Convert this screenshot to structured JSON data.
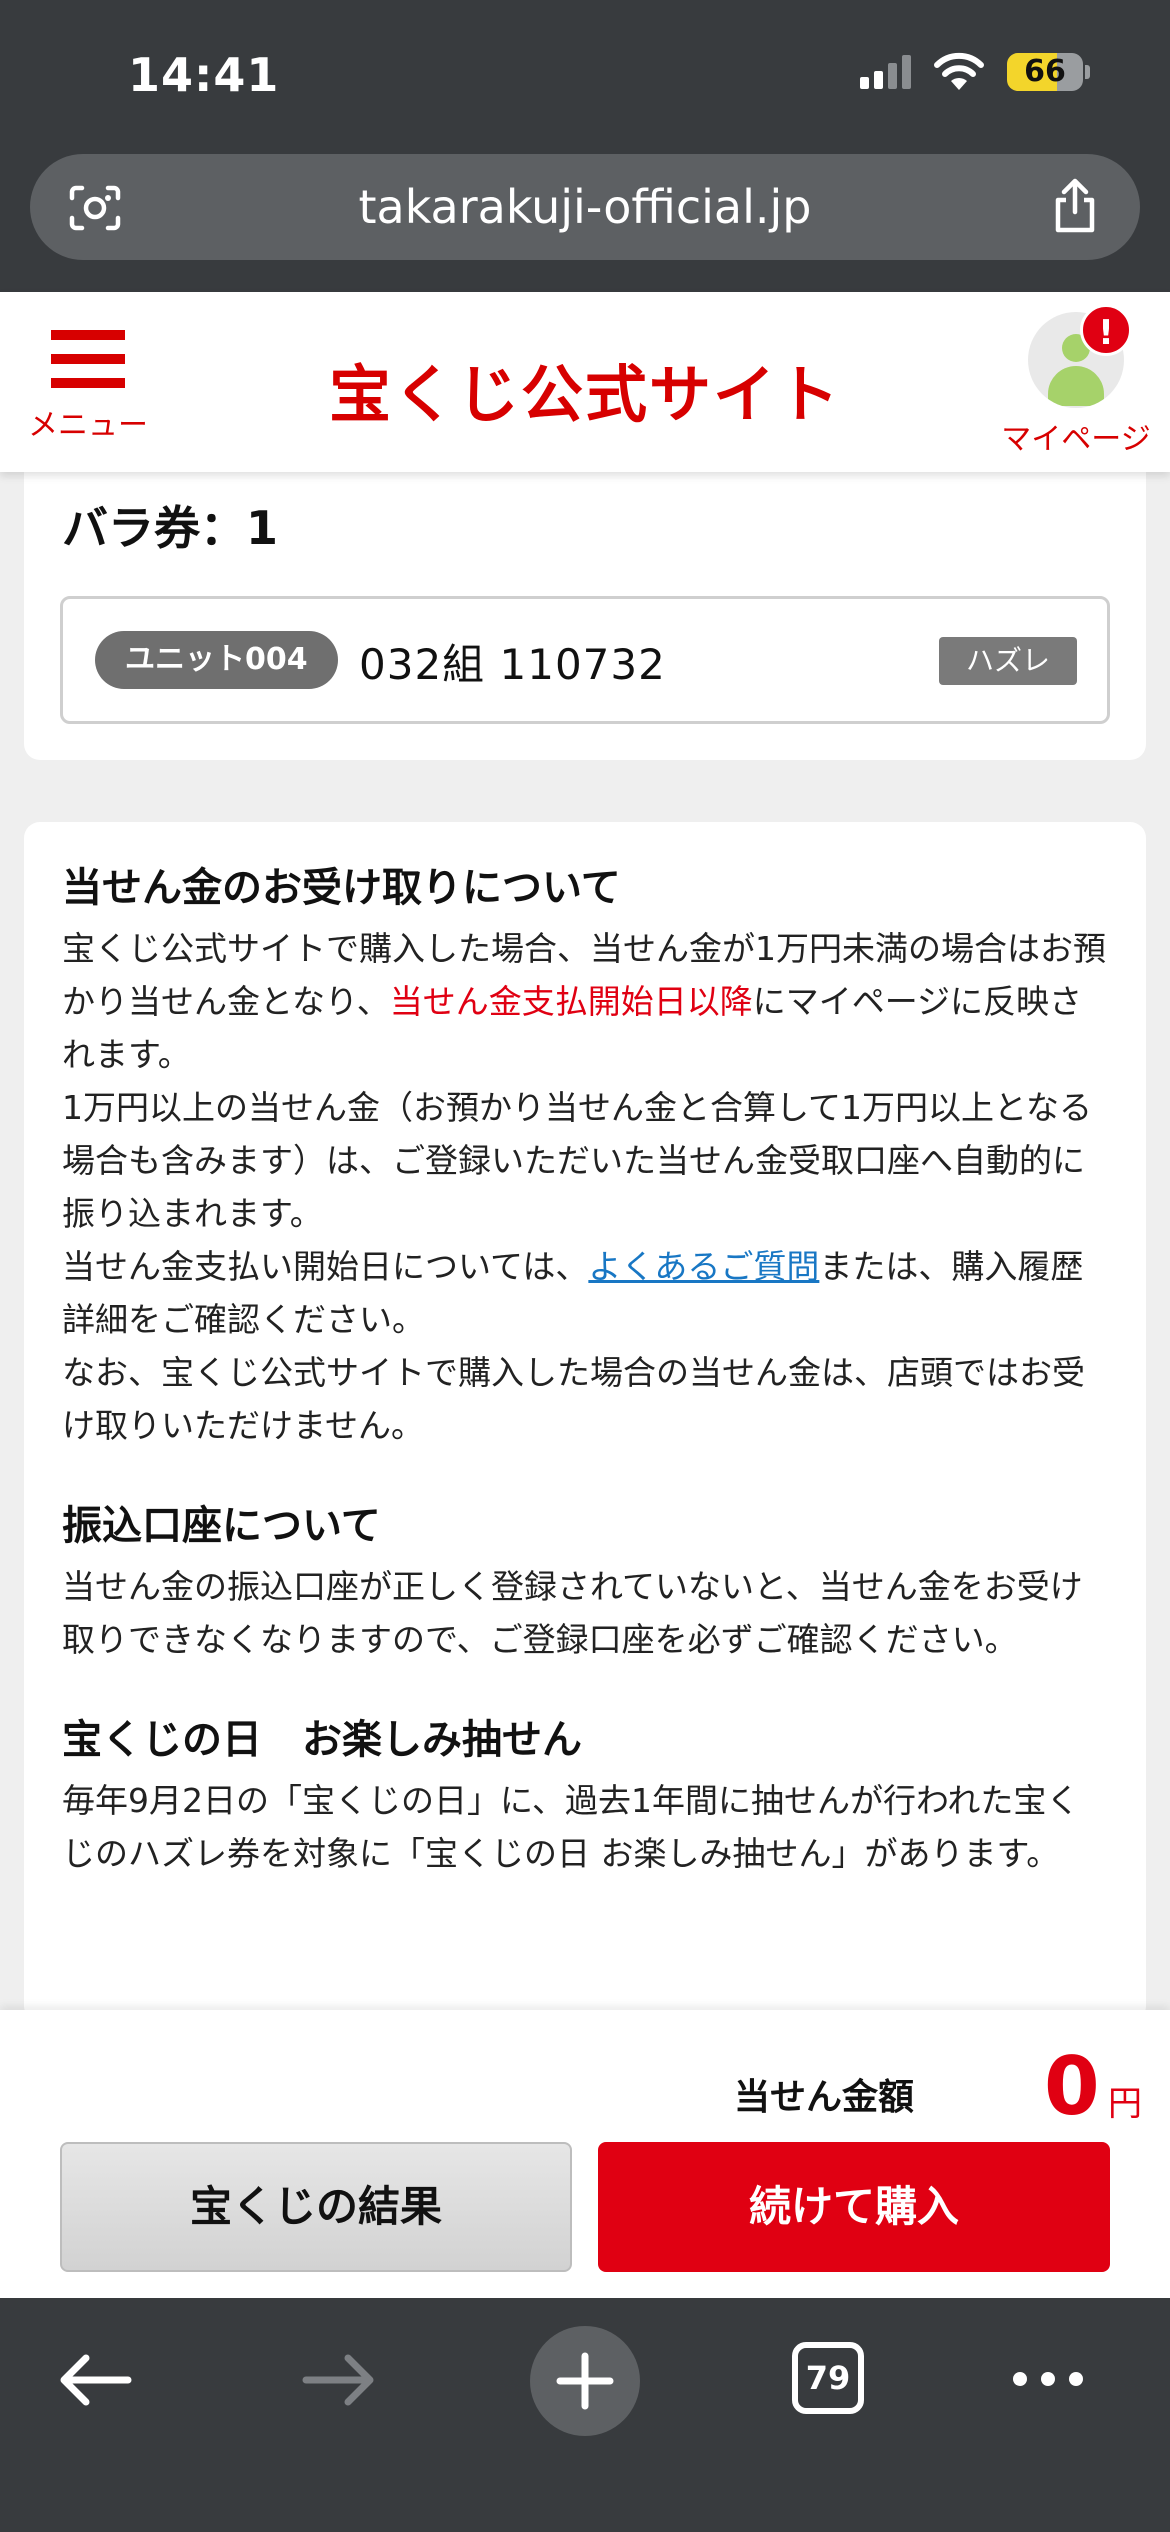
{
  "status_bar": {
    "time": "14:41",
    "battery": "66"
  },
  "browser": {
    "url": "takarakuji-official.jp",
    "tab_count": "79"
  },
  "header": {
    "menu_label": "メニュー",
    "logo": "宝くじ公式サイト",
    "mypage_label": "マイページ",
    "alert": "!"
  },
  "ticket": {
    "title": "バラ券：1",
    "unit": "ユニット004",
    "number": "032組  110732",
    "result": "ハズレ"
  },
  "info": {
    "s1_title": "当せん金のお受け取りについて",
    "s1_a": "宝くじ公式サイトで購入した場合、当せん金が1万円未満の場合はお預かり当せん金となり、",
    "s1_red": "当せん金支払開始日以降",
    "s1_b": "にマイページに反映されます。",
    "s1_c": "1万円以上の当せん金（お預かり当せん金と合算して1万円以上となる場合も含みます）は、ご登録いただいた当せん金受取口座へ自動的に振り込まれます。",
    "s1_d": "当せん金支払い開始日については、",
    "s1_link": "よくあるご質問",
    "s1_e": "または、購入履歴詳細をご確認ください。",
    "s1_f": "なお、宝くじ公式サイトで購入した場合の当せん金は、店頭ではお受け取りいただけません。",
    "s2_title": "振込口座について",
    "s2_text": "当せん金の振込口座が正しく登録されていないと、当せん金をお受け取りできなくなりますので、ご登録口座を必ずご確認ください。",
    "s3_title": "宝くじの日　お楽しみ抽せん",
    "s3_text": "毎年9月2日の「宝くじの日」に、過去1年間に抽せんが行われた宝くじのハズレ券を対象に「宝くじの日 お楽しみ抽せん」があります。"
  },
  "purchase_bar": {
    "prize_label": "当せん金額",
    "prize_value": "0",
    "prize_unit": "円",
    "results_button": "宝くじの結果",
    "buy_button": "続けて購入"
  },
  "colors": {
    "brand_red": "#d70000",
    "accent_red": "#e00012",
    "link_blue": "#1877c4",
    "browser_chrome": "#383b3e"
  }
}
